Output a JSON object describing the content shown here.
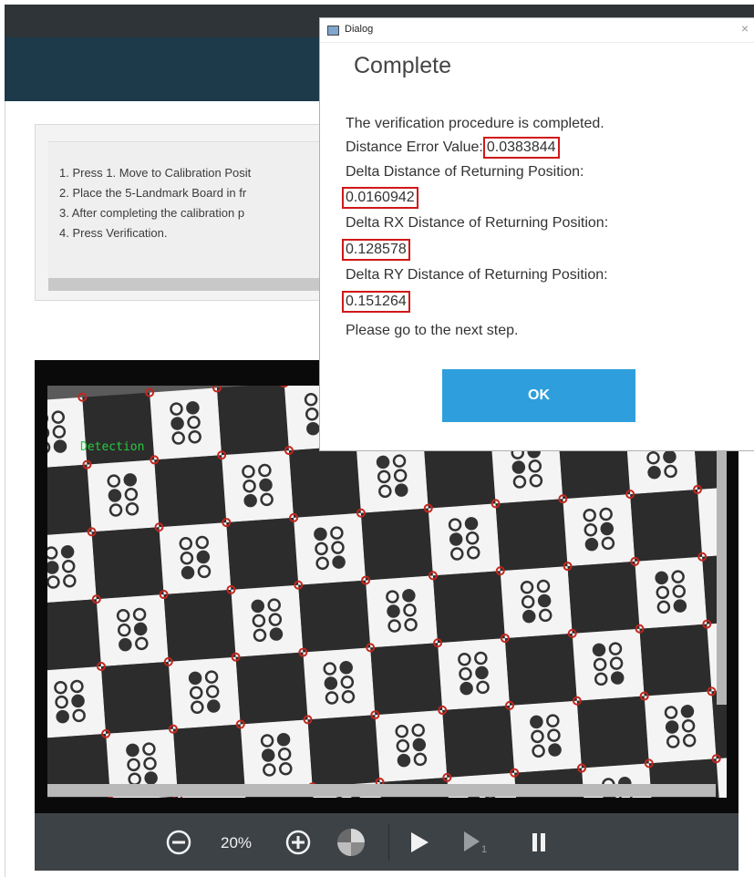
{
  "dialog": {
    "window_title": "Dialog",
    "close_glyph": "×",
    "heading": "Complete",
    "line1": "The verification procedure is completed.",
    "distance_error_label": "Distance Error Value:",
    "distance_error_value": "0.0383844",
    "delta_distance_label": "Delta Distance of Returning Position:",
    "delta_distance_value": "0.0160942",
    "delta_rx_label": "Delta RX Distance of Returning Position:",
    "delta_rx_value": "0.128578",
    "delta_ry_label": "Delta RY Distance of Returning Position:",
    "delta_ry_value": "0.151264",
    "next_step": "Please go to the next step.",
    "ok_label": "OK"
  },
  "instructions": [
    "1. Press 1. Move to Calibration Posit",
    "2. Place the 5-Landmark Board in fr",
    "3. After completing the calibration p",
    "4. Press Verification."
  ],
  "viewer": {
    "overlay_label": "Detection",
    "zoom": "20%",
    "icons": [
      "zoom-out-icon",
      "zoom-in-icon",
      "color-wheel-icon",
      "play-icon",
      "step-icon",
      "pause-icon"
    ],
    "step_subscript": "1"
  },
  "colors": {
    "header": "#1c3a4a",
    "ok_button": "#2e9fdc",
    "highlight": "#d01818",
    "detection_text": "#27c93f",
    "marker": "#c2271f"
  }
}
